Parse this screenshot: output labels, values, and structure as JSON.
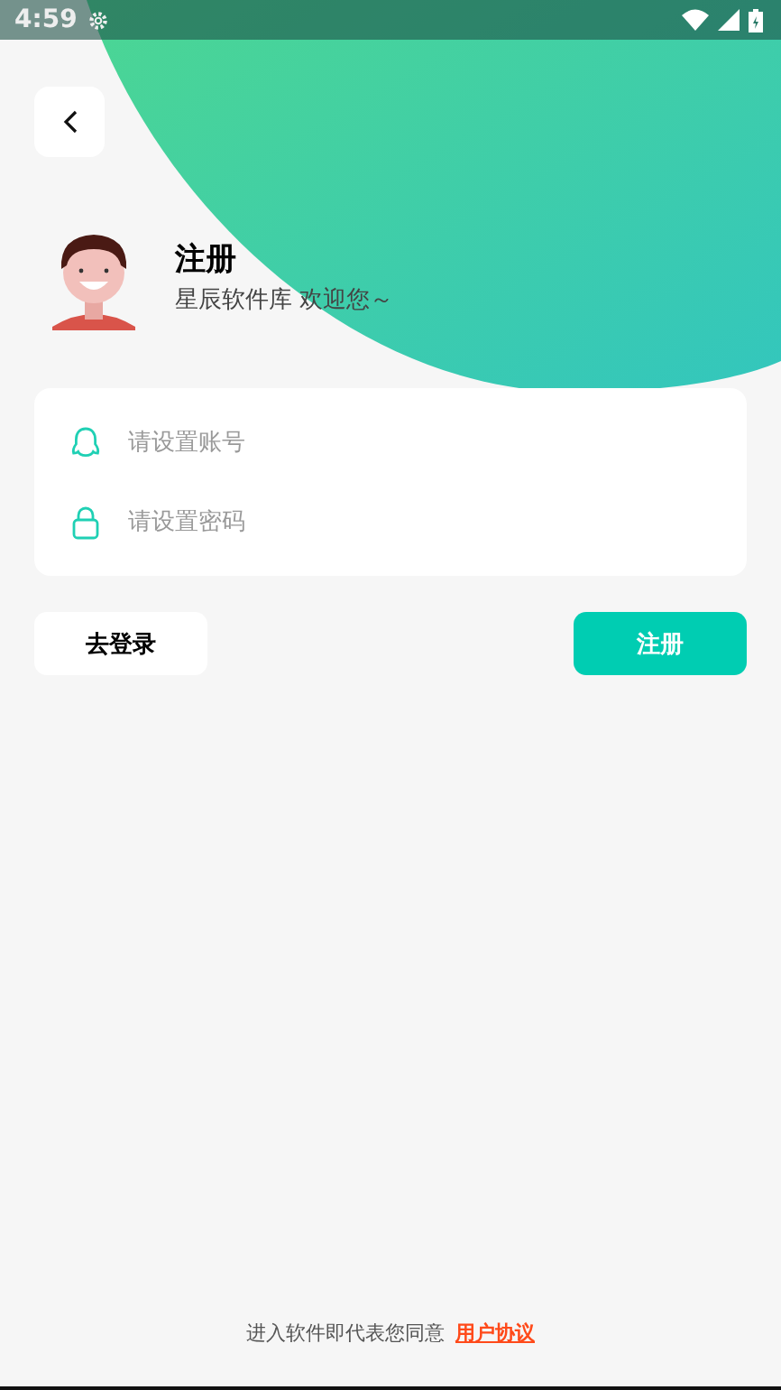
{
  "status_bar": {
    "time": "4:59"
  },
  "header": {
    "title": "注册",
    "subtitle": "星辰软件库 欢迎您～"
  },
  "form": {
    "fields": [
      {
        "kind": "account",
        "placeholder": "请设置账号"
      },
      {
        "kind": "password",
        "placeholder": "请设置密码"
      }
    ]
  },
  "buttons": [
    {
      "kind": "secondary",
      "label": "去登录"
    },
    {
      "kind": "primary",
      "label": "注册"
    }
  ],
  "footer": {
    "text": "进入软件即代表您同意",
    "link": "用户协议"
  }
}
